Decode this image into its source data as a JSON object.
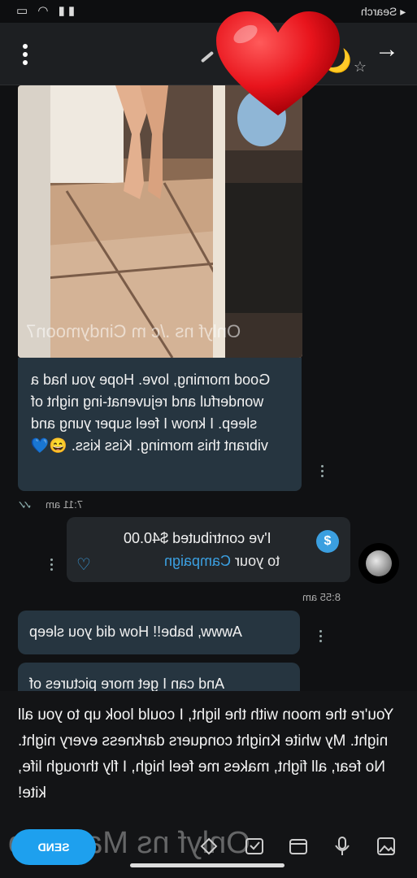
{
  "status_bar": {
    "search_label": "◂ Search",
    "icons": "wifi-icon signal-icon battery-icon"
  },
  "header": {
    "emoji_moon": "🌙",
    "star_icon": "☆",
    "back_icon": "→"
  },
  "photo": {
    "watermark": "Onlyf ns ./c m Cindymoon7"
  },
  "caption": {
    "text": "Good morning, love. Hope you had a wonderful and rejuvenat-ing night of sleep. I know I feel super yung and vibrant this morning. Kiss kiss. 😄💙"
  },
  "caption_time": "7:11 am",
  "tip": {
    "line1": "I've contributed $40.00",
    "line2_prefix": "to your ",
    "line2_link": "Campaign",
    "currency_icon": "$"
  },
  "tip_time": "8:55 am",
  "messages": [
    {
      "text": "Awww, babe!! How did you sleep"
    },
    {
      "text": "And can I get more pictures of"
    }
  ],
  "overlay": {
    "text": "You're the moon with the light, I could look up to you all night. My white Knight conquers darkness every night. No fear, all fight, makes me feel high, I fly through life, kite!"
  },
  "composer": {
    "send_label": "SEND",
    "watermark": "Onlyf ns Ma ibero"
  },
  "colors": {
    "bubble": "#263540",
    "accent": "#3b9fe0",
    "send": "#1ea0ee",
    "heart": "#e8141c"
  }
}
